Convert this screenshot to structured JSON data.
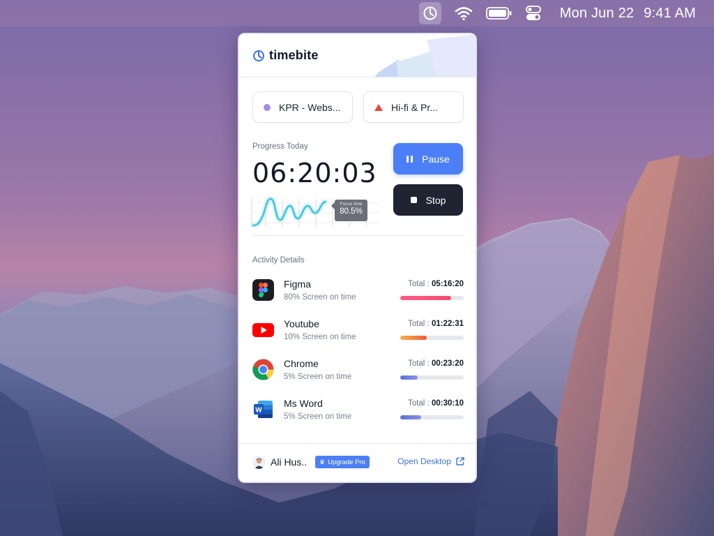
{
  "menubar": {
    "date": "Mon Jun 22",
    "time": "9:41 AM",
    "icons": [
      "timebite-menu-icon",
      "wifi-icon",
      "battery-icon",
      "control-center-icon"
    ]
  },
  "app": {
    "name": "timebite"
  },
  "projects": [
    {
      "label": "KPR - Webs...",
      "marker": "circle",
      "color": "#a08ee6"
    },
    {
      "label": "Hi-fi & Pr...",
      "marker": "triangle",
      "color": "#e8473a"
    }
  ],
  "progress": {
    "label": "Progress Today",
    "timer": "06:20:03",
    "tooltip_label": "Focus time",
    "tooltip_value": "80.5%"
  },
  "controls": {
    "pause_label": "Pause",
    "stop_label": "Stop"
  },
  "activity": {
    "label": "Activity Details",
    "total_prefix": "Total :",
    "items": [
      {
        "name": "Figma",
        "subtitle": "80% Screen on time",
        "total": "05:16:20",
        "fraction": 0.8,
        "color_from": "#ff5b8a",
        "color_to": "#f24e6f",
        "icon": "figma-icon"
      },
      {
        "name": "Youtube",
        "subtitle": "10% Screen on time",
        "total": "01:22:31",
        "fraction": 0.42,
        "color_from": "#f6b24a",
        "color_to": "#f05a3a",
        "icon": "youtube-icon"
      },
      {
        "name": "Chrome",
        "subtitle": "5% Screen on time",
        "total": "00:23:20",
        "fraction": 0.28,
        "color_from": "#5b6fd6",
        "color_to": "#8a92e8",
        "icon": "chrome-icon"
      },
      {
        "name": "Ms Word",
        "subtitle": "5% Screen on time",
        "total": "00:30:10",
        "fraction": 0.33,
        "color_from": "#5b6fd6",
        "color_to": "#8a92e8",
        "icon": "word-icon"
      }
    ]
  },
  "footer": {
    "user_name": "Ali Hus..",
    "upgrade_label": "Upgrade Pro",
    "open_desktop_label": "Open Desktop"
  },
  "colors": {
    "accent": "#4c7ff5",
    "dark_button": "#1f2332",
    "wave": "#3cc3dc"
  }
}
